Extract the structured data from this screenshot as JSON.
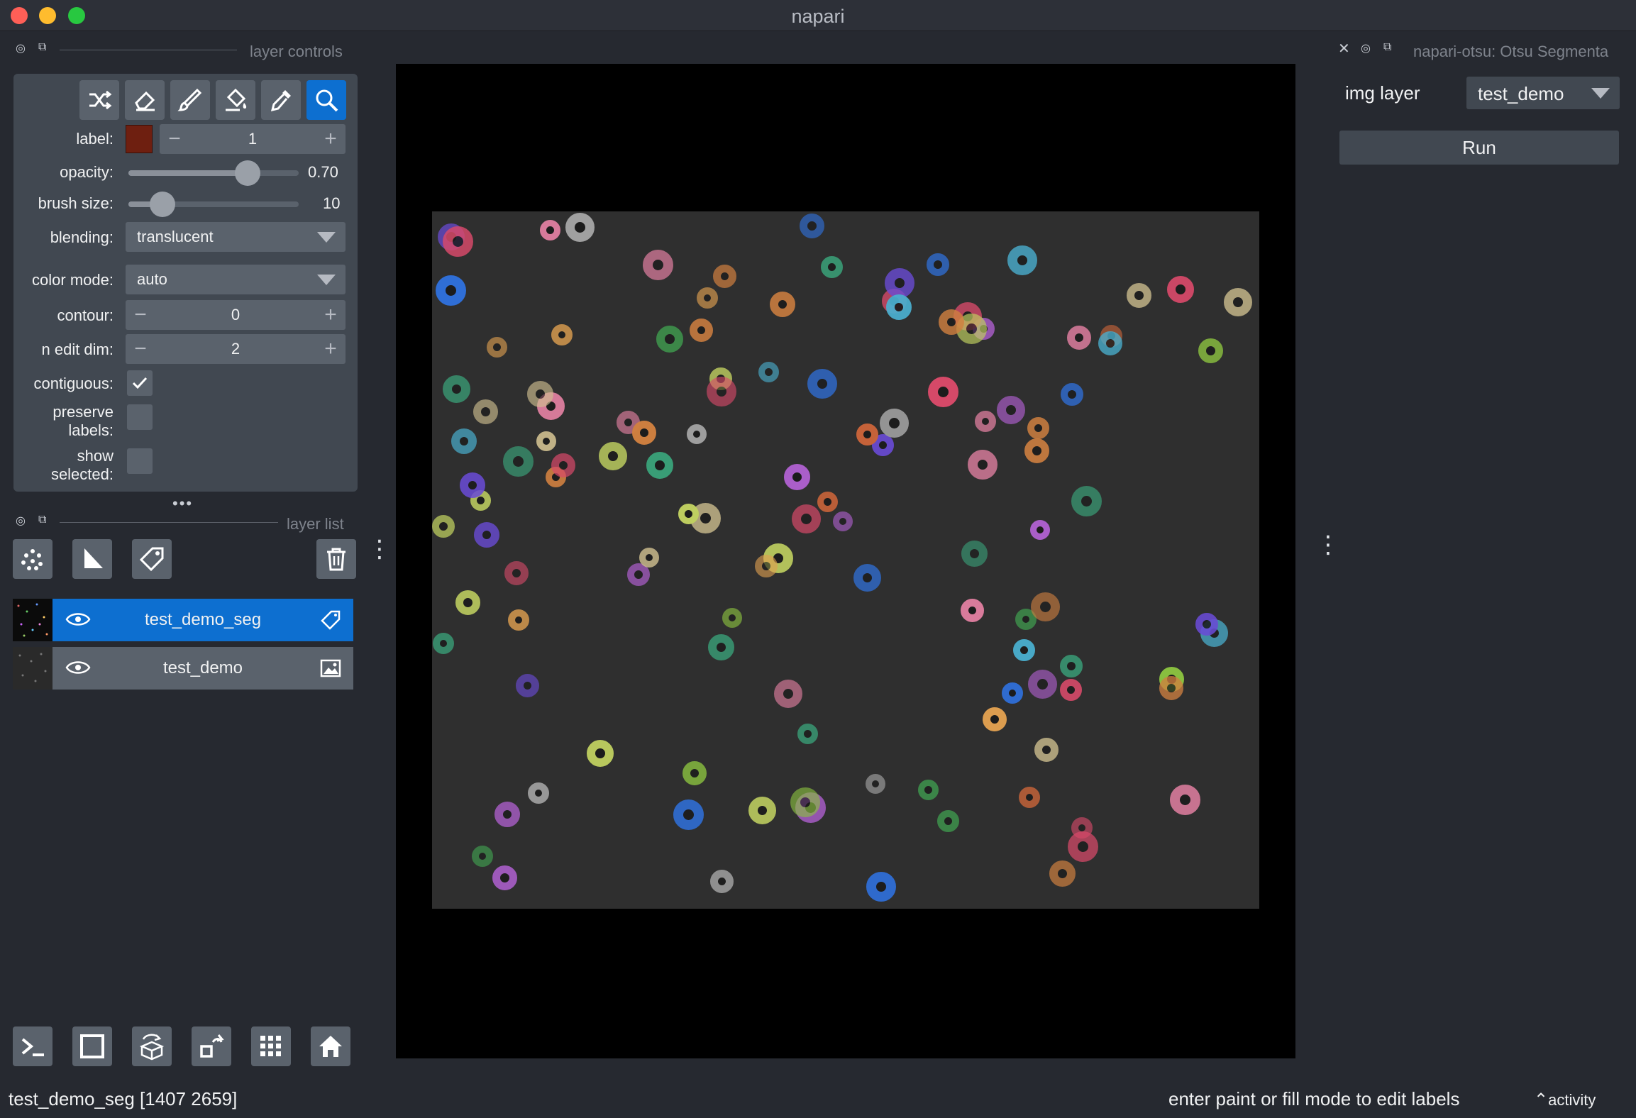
{
  "app": {
    "title": "napari"
  },
  "docks": {
    "layer_controls_title": "layer controls",
    "layer_list_title": "layer list",
    "plugin_title": "napari-otsu: Otsu Segmenta"
  },
  "layer_controls": {
    "tools": [
      {
        "name": "shuffle-colors-icon"
      },
      {
        "name": "erase-icon"
      },
      {
        "name": "paint-brush-icon"
      },
      {
        "name": "fill-bucket-icon"
      },
      {
        "name": "color-picker-icon"
      },
      {
        "name": "zoom-pan-icon",
        "active": true
      }
    ],
    "label": {
      "caption": "label:",
      "value": "1",
      "color": "#6e1f10"
    },
    "opacity": {
      "caption": "opacity:",
      "value_text": "0.70",
      "fraction": 0.7
    },
    "brush_size": {
      "caption": "brush size:",
      "value_text": "10",
      "fraction": 0.2
    },
    "blending": {
      "caption": "blending:",
      "value": "translucent"
    },
    "color_mode": {
      "caption": "color mode:",
      "value": "auto"
    },
    "contour": {
      "caption": "contour:",
      "value": "0"
    },
    "n_edit_dim": {
      "caption": "n edit dim:",
      "value": "2"
    },
    "contiguous": {
      "caption": "contiguous:",
      "checked": true
    },
    "preserve_labels": {
      "caption": "preserve\nlabels:",
      "checked": false
    },
    "show_selected": {
      "caption": "show\nselected:",
      "checked": false
    }
  },
  "layer_list": {
    "buttons": [
      "new-points-layer-icon",
      "new-shapes-layer-icon",
      "new-labels-layer-icon",
      "delete-layer-icon"
    ],
    "layers": [
      {
        "name": "test_demo_seg",
        "type": "labels",
        "selected": true,
        "visible": true
      },
      {
        "name": "test_demo",
        "type": "image",
        "selected": false,
        "visible": true
      }
    ]
  },
  "viewer_buttons": [
    "console-icon",
    "ndisplay-icon",
    "roll-dims-icon",
    "transpose-icon",
    "grid-icon",
    "home-icon"
  ],
  "plugin": {
    "img_layer_label": "img layer",
    "img_layer_value": "test_demo",
    "run_label": "Run"
  },
  "status": {
    "left": "test_demo_seg [1407 2659]",
    "right": "enter paint or fill mode to edit labels",
    "activity": "activity"
  },
  "colors": {
    "accent": "#0d6fd0",
    "panel": "#414851",
    "background": "#262930"
  }
}
